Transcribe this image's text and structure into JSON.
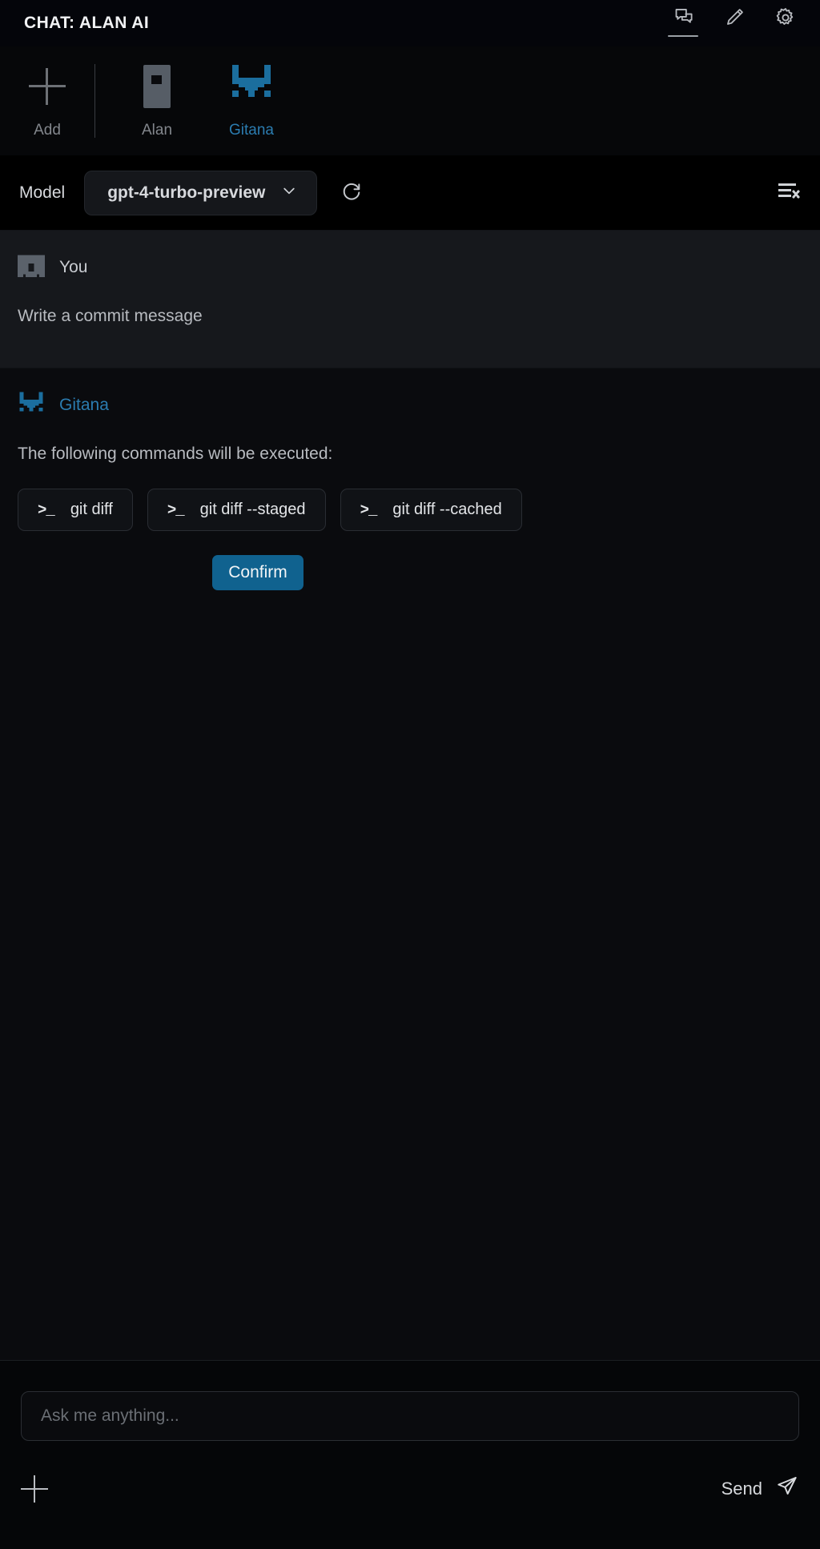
{
  "window": {
    "title": "CHAT: ALAN AI"
  },
  "titlebar_actions": [
    {
      "name": "chats-icon",
      "tooltip": "Chats",
      "active": true
    },
    {
      "name": "edit-icon",
      "tooltip": "Edit",
      "active": false
    },
    {
      "name": "settings-gear-icon",
      "tooltip": "Settings",
      "active": false
    }
  ],
  "agent_tabs": {
    "add": {
      "label": "Add",
      "icon": "plus-icon"
    },
    "items": [
      {
        "label": "Alan",
        "icon": "alan-avatar-icon",
        "active": false
      },
      {
        "label": "Gitana",
        "icon": "gitana-robot-icon",
        "active": true
      }
    ]
  },
  "model_bar": {
    "label": "Model",
    "selected": "gpt-4-turbo-preview",
    "options": [
      "gpt-4-turbo-preview"
    ],
    "refresh_icon": "refresh-icon",
    "clear_icon": "clear-chat-icon"
  },
  "conversation": {
    "messages": [
      {
        "author": "You",
        "role": "user",
        "avatar": "user-pixel-avatar",
        "text": "Write a commit message"
      },
      {
        "author": "Gitana",
        "role": "assistant",
        "avatar": "gitana-robot-icon",
        "text": "The following commands will be executed:",
        "commands": [
          "git diff",
          "git diff --staged",
          "git diff --cached"
        ],
        "confirm_label": "Confirm"
      }
    ]
  },
  "composer": {
    "placeholder": "Ask me anything...",
    "value": "",
    "attach_icon": "plus-icon",
    "send_label": "Send",
    "send_icon": "paper-plane-icon"
  },
  "colors": {
    "accent": "#2b7cb0",
    "confirm_bg": "#10628f",
    "window_bg": "#0a0b0e",
    "user_msg_bg": "#16181c",
    "muted_text": "#82868c"
  }
}
